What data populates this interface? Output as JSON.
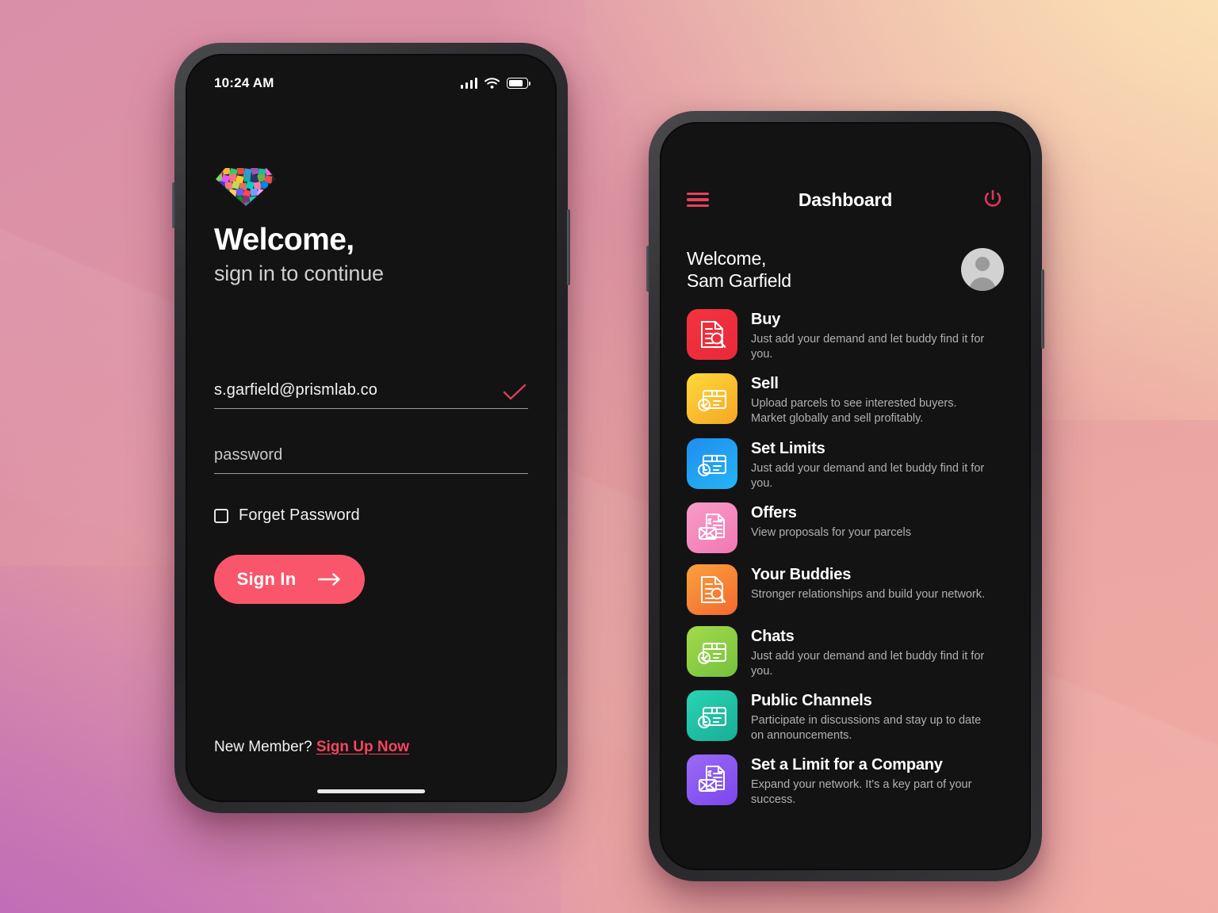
{
  "background": {
    "colors": [
      "#d98fa8",
      "#fbe3b6",
      "#bf6ec4",
      "#f2aaa2"
    ]
  },
  "theme": {
    "accent": "#f9566b",
    "link": "#f4455f",
    "screen_bg": "#131314",
    "bezel": "#2b2b2e"
  },
  "login_phone": {
    "status_bar": {
      "time": "10:24 AM",
      "signal_icon": "signal-bars-icon",
      "wifi_icon": "wifi-icon",
      "battery_icon": "battery-icon"
    },
    "logo_name": "prism-diamond-logo",
    "heading": "Welcome,",
    "subtitle": "sign in to continue",
    "email_field": {
      "value": "s.garfield@prismlab.co",
      "placeholder": "email",
      "valid_icon": "check-icon"
    },
    "password_field": {
      "value": "",
      "placeholder": "password"
    },
    "forget_password": {
      "label": "Forget Password",
      "checked": false
    },
    "sign_in_button": {
      "label": "Sign In",
      "icon": "arrow-right-icon"
    },
    "footer": {
      "prompt": "New Member?",
      "link": "Sign Up Now"
    },
    "home_indicator": "home-indicator"
  },
  "dashboard_phone": {
    "header": {
      "menu_icon": "hamburger-menu-icon",
      "title": "Dashboard",
      "power_icon": "power-icon"
    },
    "welcome": {
      "greeting": "Welcome,",
      "user_name": "Sam Garfield",
      "avatar": "user-avatar"
    },
    "items": [
      {
        "title": "Buy",
        "desc": "Just add your demand and let buddy find it for you.",
        "color_from": "#f5333f",
        "color_to": "#e8293a",
        "icon": "document-search-icon"
      },
      {
        "title": "Sell",
        "desc": "Upload parcels to see interested buyers. Market globally and sell profitably.",
        "color_from": "#ffd93b",
        "color_to": "#f5a623",
        "icon": "box-check-icon"
      },
      {
        "title": "Set Limits",
        "desc": "Just add your demand and let buddy find it for you.",
        "color_from": "#1f8df0",
        "color_to": "#25b5f5",
        "icon": "box-clock-icon"
      },
      {
        "title": "Offers",
        "desc": "View proposals for your parcels",
        "color_from": "#f89cc8",
        "color_to": "#f277b4",
        "icon": "invoice-envelope-icon"
      },
      {
        "title": "Your Buddies",
        "desc": "Stronger relationships and build your network.",
        "color_from": "#f9a23c",
        "color_to": "#f4682f",
        "icon": "document-search-icon"
      },
      {
        "title": "Chats",
        "desc": "Just add your demand and let buddy find it for you.",
        "color_from": "#a4d94a",
        "color_to": "#74c23e",
        "icon": "box-check-icon"
      },
      {
        "title": "Public Channels",
        "desc": "Participate in discussions and stay up to date on announcements.",
        "color_from": "#2ad3b4",
        "color_to": "#19ae96",
        "icon": "box-clock-icon"
      },
      {
        "title": "Set a Limit for a Company",
        "desc": "Expand your network. It's a key part of your success.",
        "color_from": "#9a6bf5",
        "color_to": "#7c45ee",
        "icon": "invoice-envelope-icon"
      }
    ]
  }
}
